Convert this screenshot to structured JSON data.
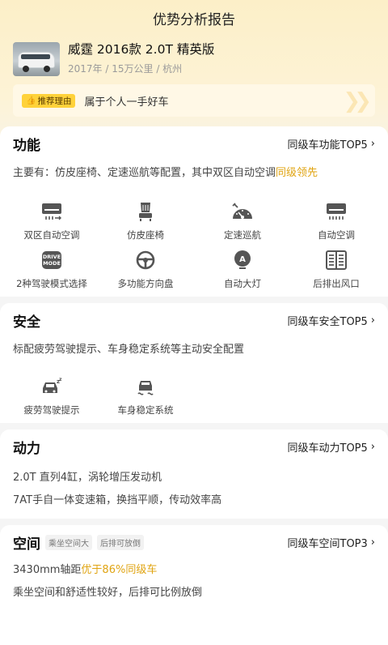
{
  "header": {
    "title": "优势分析报告"
  },
  "car": {
    "name": "威霆 2016款 2.0T 精英版",
    "meta": [
      "2017年",
      "15万公里",
      "杭州"
    ]
  },
  "reason": {
    "badge": "推荐理由",
    "text": "属于个人一手好车"
  },
  "sections": {
    "function": {
      "title": "功能",
      "link": "同级车功能TOP5",
      "desc_prefix": "主要有：仿皮座椅、定速巡航等配置，其中双区自动空调",
      "desc_highlight": "同级领先",
      "features": [
        {
          "label": "双区自动空调",
          "icon": "dual-zone-ac-icon"
        },
        {
          "label": "仿皮座椅",
          "icon": "seat-icon"
        },
        {
          "label": "定速巡航",
          "icon": "cruise-control-icon"
        },
        {
          "label": "自动空调",
          "icon": "auto-ac-icon"
        },
        {
          "label": "2种驾驶模式选择",
          "icon": "drive-mode-icon"
        },
        {
          "label": "多功能方向盘",
          "icon": "steering-wheel-icon"
        },
        {
          "label": "自动大灯",
          "icon": "auto-headlight-icon"
        },
        {
          "label": "后排出风口",
          "icon": "rear-vent-icon"
        }
      ],
      "drive_mode_icon_text": [
        "DRIVE",
        "MODE"
      ],
      "auto_light_icon_text": "A"
    },
    "safety": {
      "title": "安全",
      "link": "同级车安全TOP5",
      "desc": "标配疲劳驾驶提示、车身稳定系统等主动安全配置",
      "features": [
        {
          "label": "疲劳驾驶提示",
          "icon": "fatigue-alert-icon"
        },
        {
          "label": "车身稳定系统",
          "icon": "stability-control-icon"
        }
      ]
    },
    "power": {
      "title": "动力",
      "link": "同级车动力TOP5",
      "lines": [
        "2.0T 直列4缸，涡轮增压发动机",
        "7AT手自一体变速箱，换挡平顺，传动效率高"
      ]
    },
    "space": {
      "title": "空间",
      "tags": [
        "乘坐空间大",
        "后排可放倒"
      ],
      "link": "同级车空间TOP3",
      "line1_prefix": "3430mm轴距",
      "line1_highlight": "优于86%同级车",
      "line2": "乘坐空间和舒适性较好，后排可比例放倒"
    }
  },
  "colors": {
    "highlight": "#e0a412",
    "badge": "#ffd23a",
    "header_bg": "#fcefc8"
  }
}
